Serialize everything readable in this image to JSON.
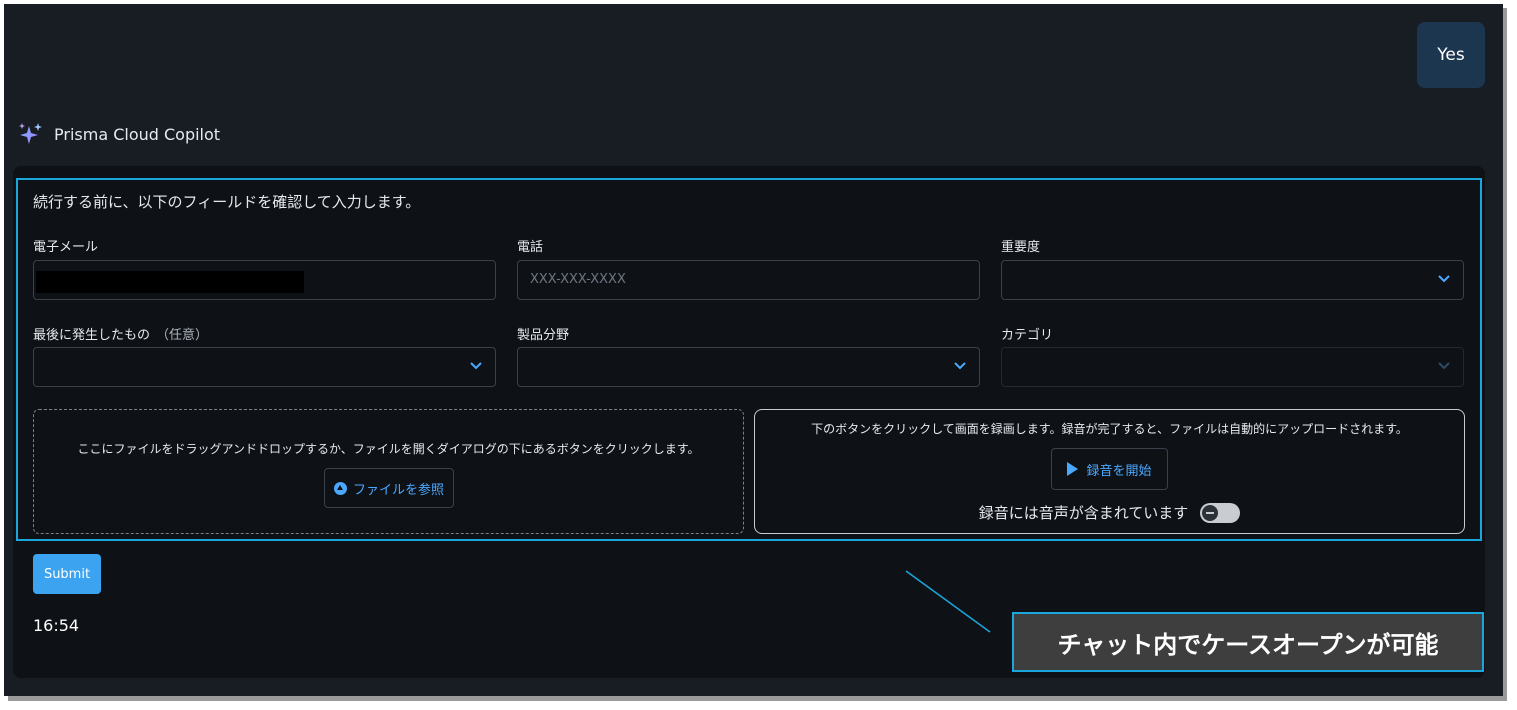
{
  "chat": {
    "user_message": "Yes",
    "assistant_name": "Prisma Cloud Copilot",
    "timestamp": "16:54"
  },
  "form": {
    "intro": "続行する前に、以下のフィールドを確認して入力します。",
    "email": {
      "label": "電子メール",
      "value": ""
    },
    "phone": {
      "label": "電話",
      "placeholder": "XXX-XXX-XXXX"
    },
    "severity": {
      "label": "重要度",
      "value": ""
    },
    "last_occurred": {
      "label": "最後に発生したもの",
      "optional": "（任意）",
      "value": ""
    },
    "product_area": {
      "label": "製品分野",
      "value": ""
    },
    "category": {
      "label": "カテゴリ",
      "value": ""
    },
    "dropzone": {
      "text": "ここにファイルをドラッグアンドドロップするか、ファイルを開くダイアログの下にあるボタンをクリックします。",
      "browse_label": "ファイルを参照"
    },
    "recording": {
      "text": "下のボタンをクリックして画面を録画します。録音が完了すると、ファイルは自動的にアップロードされます。",
      "start_label": "録音を開始",
      "audio_label": "録音には音声が含まれています",
      "audio_enabled": false
    },
    "submit_label": "Submit"
  },
  "annotation": {
    "callout": "チャット内でケースオープンが可能"
  },
  "colors": {
    "background": "#181d24",
    "card": "#0e1217",
    "accent": "#3ba3f0",
    "highlight_border": "#1ba6dc",
    "user_bubble": "#1d3650"
  }
}
